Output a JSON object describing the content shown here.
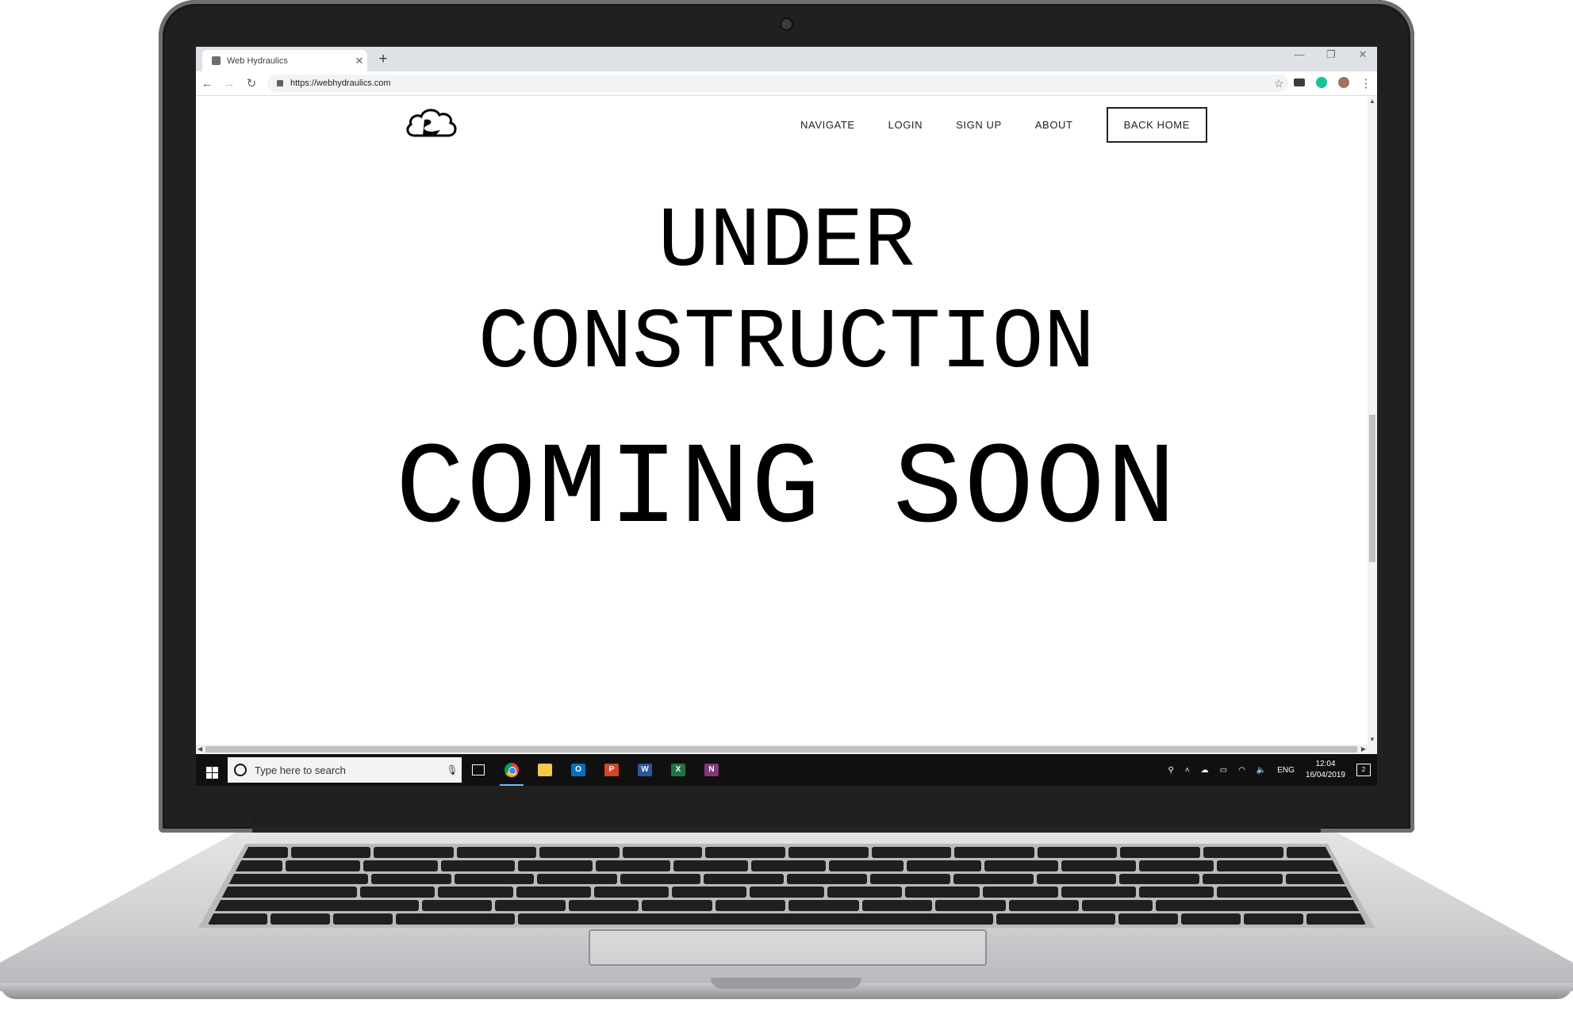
{
  "browser": {
    "tab_title": "Web Hydraulics",
    "tab_close": "✕",
    "new_tab": "+",
    "window_controls": [
      "—",
      "❐",
      "✕"
    ],
    "back": "←",
    "forward": "→",
    "reload": "↻",
    "url": "https://webhydraulics.com",
    "bookmark_star": "☆",
    "menu": "⋮"
  },
  "site": {
    "nav": [
      "NAVIGATE",
      "LOGIN",
      "SIGN UP",
      "ABOUT"
    ],
    "back_home": "BACK HOME",
    "line1": "UNDER",
    "line2": "CONSTRUCTION",
    "line3": "COMING SOON"
  },
  "taskbar": {
    "search_placeholder": "Type here to search",
    "apps": [
      {
        "name": "Chrome",
        "icon": "chrome-icon"
      },
      {
        "name": "File Explorer",
        "icon": "folder-icon",
        "color": "#f7c948"
      },
      {
        "name": "Outlook",
        "icon": "outlook-icon",
        "color": "#0072c6",
        "glyph": "O"
      },
      {
        "name": "PowerPoint",
        "icon": "powerpoint-icon",
        "color": "#d24726",
        "glyph": "P"
      },
      {
        "name": "Word",
        "icon": "word-icon",
        "color": "#2b579a",
        "glyph": "W"
      },
      {
        "name": "Excel",
        "icon": "excel-icon",
        "color": "#217346",
        "glyph": "X"
      },
      {
        "name": "OneNote",
        "icon": "onenote-icon",
        "color": "#80397b",
        "glyph": "N"
      }
    ],
    "language": "ENG",
    "time": "12:04",
    "date": "16/04/2019",
    "notifications": "2"
  },
  "colors": {
    "accent": "#000000",
    "taskbar": "#101010",
    "chrome_tabstrip": "#dee1e6"
  }
}
